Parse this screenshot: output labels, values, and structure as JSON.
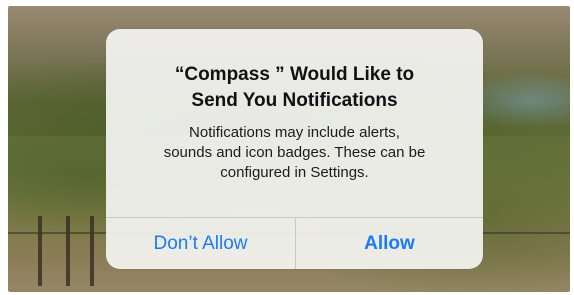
{
  "alert": {
    "title_line1": "“Compass ” Would Like to",
    "title_line2": "Send You Notifications",
    "message_line1": "Notifications may include alerts,",
    "message_line2": "sounds and icon badges. These can be",
    "message_line3": "configured in Settings.",
    "deny_label": "Don’t Allow",
    "allow_label": "Allow"
  },
  "colors": {
    "button_text": "#1a7cf5",
    "alert_background": "#f4f4f2",
    "divider": "#c9c8c4"
  }
}
